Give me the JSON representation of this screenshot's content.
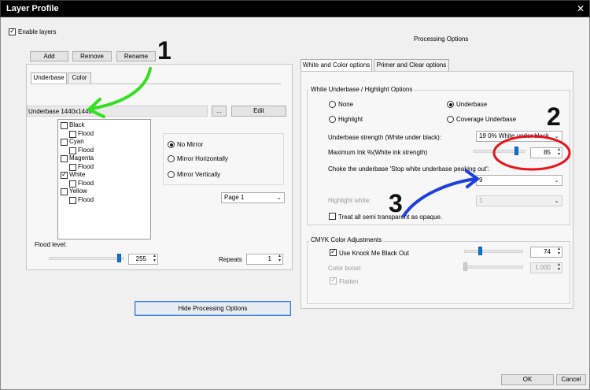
{
  "window": {
    "title": "Layer Profile",
    "close_glyph": "✕"
  },
  "enable_layers": {
    "label": "Enable layers",
    "checked": true
  },
  "processing_options_heading": "Processing Options",
  "layer_buttons": {
    "add": "Add",
    "remove": "Remove",
    "rename": "Rename"
  },
  "left_tabs": {
    "underbase": "Underbase",
    "color": "Color"
  },
  "underbase_file": {
    "value": "Underbase 1440x1440",
    "browse": "...",
    "edit": "Edit"
  },
  "channels": [
    {
      "label": "Black",
      "checked": false
    },
    {
      "label": "Flood",
      "checked": false
    },
    {
      "label": "Cyan",
      "checked": false
    },
    {
      "label": "Flood",
      "checked": false
    },
    {
      "label": "Magenta",
      "checked": false
    },
    {
      "label": "Flood",
      "checked": false
    },
    {
      "label": "White",
      "checked": true
    },
    {
      "label": "Flood",
      "checked": false
    },
    {
      "label": "Yellow",
      "checked": false
    },
    {
      "label": "Flood",
      "checked": false
    }
  ],
  "mirror": {
    "none": "No Mirror",
    "horizontal": "Mirror Horizontally",
    "vertical": "Mirror Vertically",
    "selected": "none"
  },
  "page_select": "Page 1",
  "flood_level": {
    "label": "Flood level:",
    "value": "255",
    "slider_fraction": 0.96
  },
  "repeats": {
    "label": "Repeats",
    "value": "1"
  },
  "hide_button": "Hide Processing Options",
  "right_tabs": {
    "white_color": "White and Color options",
    "primer_clear": "Primer and Clear options"
  },
  "underbase_group": {
    "title": "White Underbase / Highlight Options",
    "radios": {
      "none": "None",
      "underbase": "Underbase",
      "highlight": "Highlight",
      "coverage": "Coverage Underbase",
      "selected": "underbase"
    },
    "strength_label": "Underbase strength (White under black):",
    "strength_value": "19 0% White under black",
    "max_ink_label": "Maximum Ink %(White ink strength)",
    "max_ink_value": "85",
    "max_ink_fraction": 0.85,
    "choke_label": "Choke the underbase 'Stop white underbase peaking out':",
    "choke_value": "9",
    "highlight_white_label": "Highlight white:",
    "highlight_white_value": "1",
    "treat_label": "Treat all semi transparent as opaque.",
    "treat_checked": false
  },
  "cmyk_group": {
    "title": "CMYK Color Adjustments",
    "knockout_label": "Use Knock Me Black Out",
    "knockout_checked": true,
    "knockout_value": "74",
    "knockout_fraction": 0.25,
    "boost_label": "Color boost:",
    "boost_value": "1.000",
    "flatten_label": "Flatten",
    "flatten_checked": true
  },
  "footer": {
    "ok": "OK",
    "cancel": "Cancel"
  },
  "annotations": {
    "n1": "1",
    "n2": "2",
    "n3": "3",
    "green": "#31e01f",
    "red": "#e8141c",
    "blue": "#1d3fe0"
  }
}
